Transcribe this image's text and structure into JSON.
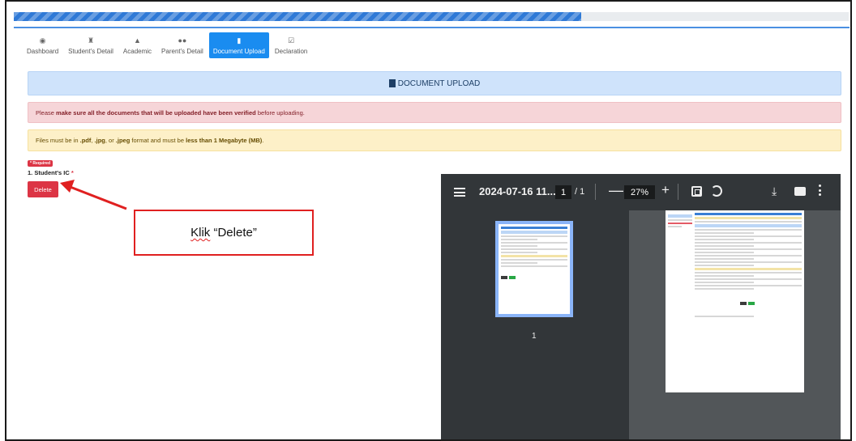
{
  "progress": {
    "percent": 68
  },
  "tabs": [
    {
      "label": "Dashboard",
      "icon": "dashboard-icon",
      "glyph": "◉"
    },
    {
      "label": "Student's Detail",
      "icon": "student-icon",
      "glyph": "♜"
    },
    {
      "label": "Academic",
      "icon": "graduation-cap-icon",
      "glyph": "▲"
    },
    {
      "label": "Parent's Detail",
      "icon": "users-icon",
      "glyph": "●●"
    },
    {
      "label": "Document Upload",
      "icon": "file-icon",
      "glyph": "▮"
    },
    {
      "label": "Declaration",
      "icon": "clipboard-check-icon",
      "glyph": "☑"
    }
  ],
  "active_tab": "Document Upload",
  "document_title": "DOCUMENT UPLOAD",
  "alert_danger": {
    "before": "Please ",
    "bold": "make sure all the documents that will be uploaded have been verified",
    "after": " before uploading."
  },
  "alert_warning": {
    "p1": "Files must be in ",
    "b1": ".pdf",
    "p2": ", ",
    "b2": ".jpg",
    "p3": ", or ",
    "b3": ".jpeg",
    "p4": " format and must be ",
    "b4": "less than 1 Megabyte (MB)",
    "p5": "."
  },
  "required_badge": "* Required",
  "field_label": "1. Student's IC",
  "required_star": "*",
  "delete_label": "Delete",
  "annotation": {
    "text_before": "",
    "klik": "Klik",
    "text_after": " “Delete”",
    "color": "#e02020"
  },
  "pdf_viewer": {
    "title": "2024-07-16 11...",
    "current_page": "1",
    "page_total": "/ 1",
    "zoom": "27%",
    "minus": "—",
    "plus": "+",
    "download_glyph": "⤓",
    "thumbnail_page_number": "1"
  },
  "colors": {
    "primary": "#1a8cf0",
    "danger": "#dc3545",
    "info_bg": "#cfe3fb",
    "danger_bg": "#f6d5d8",
    "warning_bg": "#fdf0c8"
  }
}
